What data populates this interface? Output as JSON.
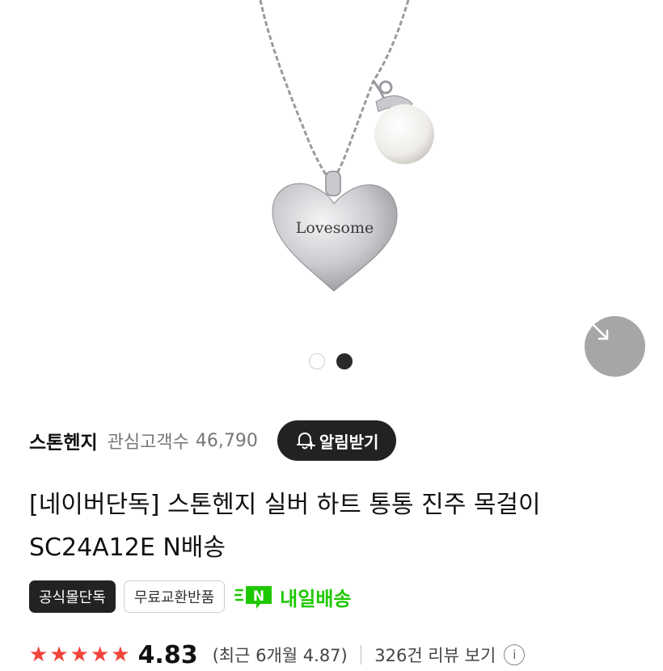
{
  "gallery": {
    "engraving": "Lovesome",
    "slide_count": 2,
    "active_slide": 2
  },
  "brand": {
    "name": "스톤헨지",
    "fans_label": "관심고객수",
    "fans_count": "46,790",
    "alarm_label": "알림받기"
  },
  "product": {
    "title": "[네이버단독] 스톤헨지 실버 하트 통통 진주 목걸이 SC24A12E N배송"
  },
  "tags": {
    "official": "공식몰단독",
    "free_return": "무료교환반품",
    "delivery_badge": "N",
    "delivery_text": "내일배송"
  },
  "rating": {
    "stars": 5,
    "value": "4.83",
    "recent": "(최근 6개월 4.87)",
    "review_link": "326건 리뷰 보기",
    "info_symbol": "i"
  },
  "colors": {
    "star": "#f0433a",
    "delivery": "#1ec800",
    "alarm_button": "#222222"
  }
}
